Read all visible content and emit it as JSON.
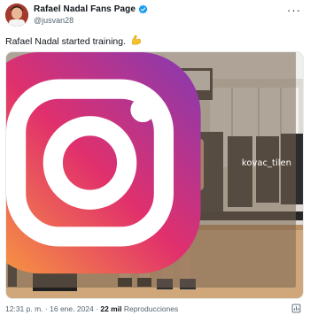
{
  "author": {
    "display_name": "Rafael Nadal Fans Page",
    "handle": "@jusvan28",
    "verified": true
  },
  "menu": {
    "more_label": "···"
  },
  "tweet": {
    "text": "Rafael Nadal started training.",
    "emoji": "flexed-biceps"
  },
  "media": {
    "watermark_text": "kovac_tilen",
    "watermark_icon": "instagram-icon"
  },
  "meta": {
    "time": "12:31 p. m.",
    "separator": "·",
    "date": "16 ene. 2024",
    "views_count": "22 mil",
    "views_label": "Reproducciones"
  },
  "colors": {
    "verified_blue": "#1d9bf0",
    "secondary_text": "#536471",
    "primary_text": "#0f1419"
  }
}
